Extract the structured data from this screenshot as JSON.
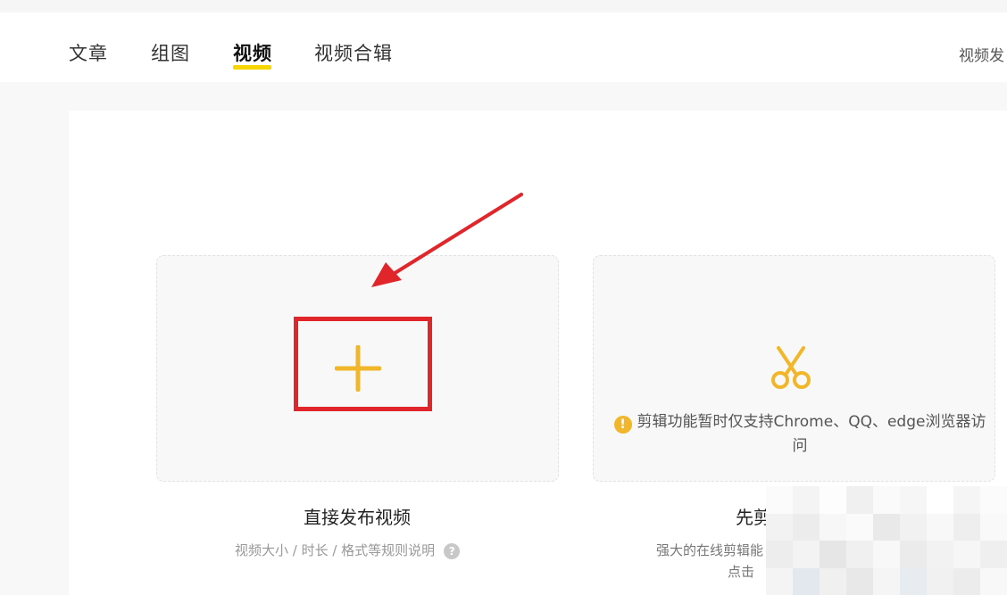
{
  "tabs": [
    {
      "label": "文章",
      "active": false
    },
    {
      "label": "组图",
      "active": false
    },
    {
      "label": "视频",
      "active": true
    },
    {
      "label": "视频合辑",
      "active": false
    }
  ],
  "header": {
    "right_link": "视频发"
  },
  "upload_card": {
    "title": "直接发布视频",
    "subtitle": "视频大小 / 时长 / 格式等规则说明",
    "help_glyph": "?",
    "icon": "plus-icon"
  },
  "edit_card": {
    "title": "先剪",
    "warning": "剪辑功能暂时仅支持Chrome、QQ、edge浏览器访问",
    "warning_glyph": "!",
    "subtitle_line1": "强大的在线剪辑能",
    "subtitle_line2": "点击",
    "icon": "scissors-icon"
  },
  "colors": {
    "accent_yellow": "#f6d500",
    "icon_yellow": "#f2b62a",
    "annotation_red": "#e0262b"
  }
}
